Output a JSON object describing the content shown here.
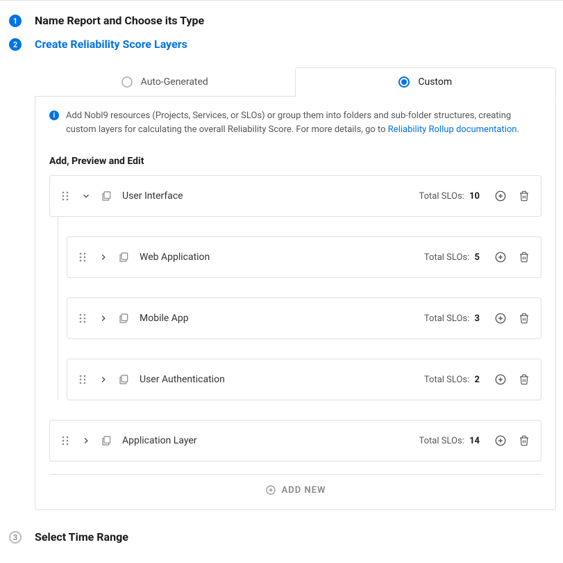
{
  "steps": {
    "s1": {
      "num": "1",
      "title": "Name Report and Choose its Type"
    },
    "s2": {
      "num": "2",
      "title": "Create Reliability Score Layers"
    },
    "s3": {
      "num": "3",
      "title": "Select Time Range"
    }
  },
  "tabs": {
    "auto": "Auto-Generated",
    "custom": "Custom"
  },
  "info": {
    "text_before": "Add Nobl9 resources (Projects, Services, or SLOs) or group them into folders and sub-folder structures, creating custom layers for calculating the overall Reliability Score. For more details, go to ",
    "link": "Reliability Rollup documentation",
    "text_after": "."
  },
  "section": {
    "title": "Add, Preview and Edit"
  },
  "slo_label": "Total SLOs:",
  "layers": [
    {
      "name": "User Interface",
      "slos": "10",
      "expanded": true,
      "children": [
        {
          "name": "Web Application",
          "slos": "5"
        },
        {
          "name": "Mobile App",
          "slos": "3"
        },
        {
          "name": "User Authentication",
          "slos": "2"
        }
      ]
    },
    {
      "name": "Application Layer",
      "slos": "14",
      "expanded": false
    }
  ],
  "add_new": "ADD NEW"
}
